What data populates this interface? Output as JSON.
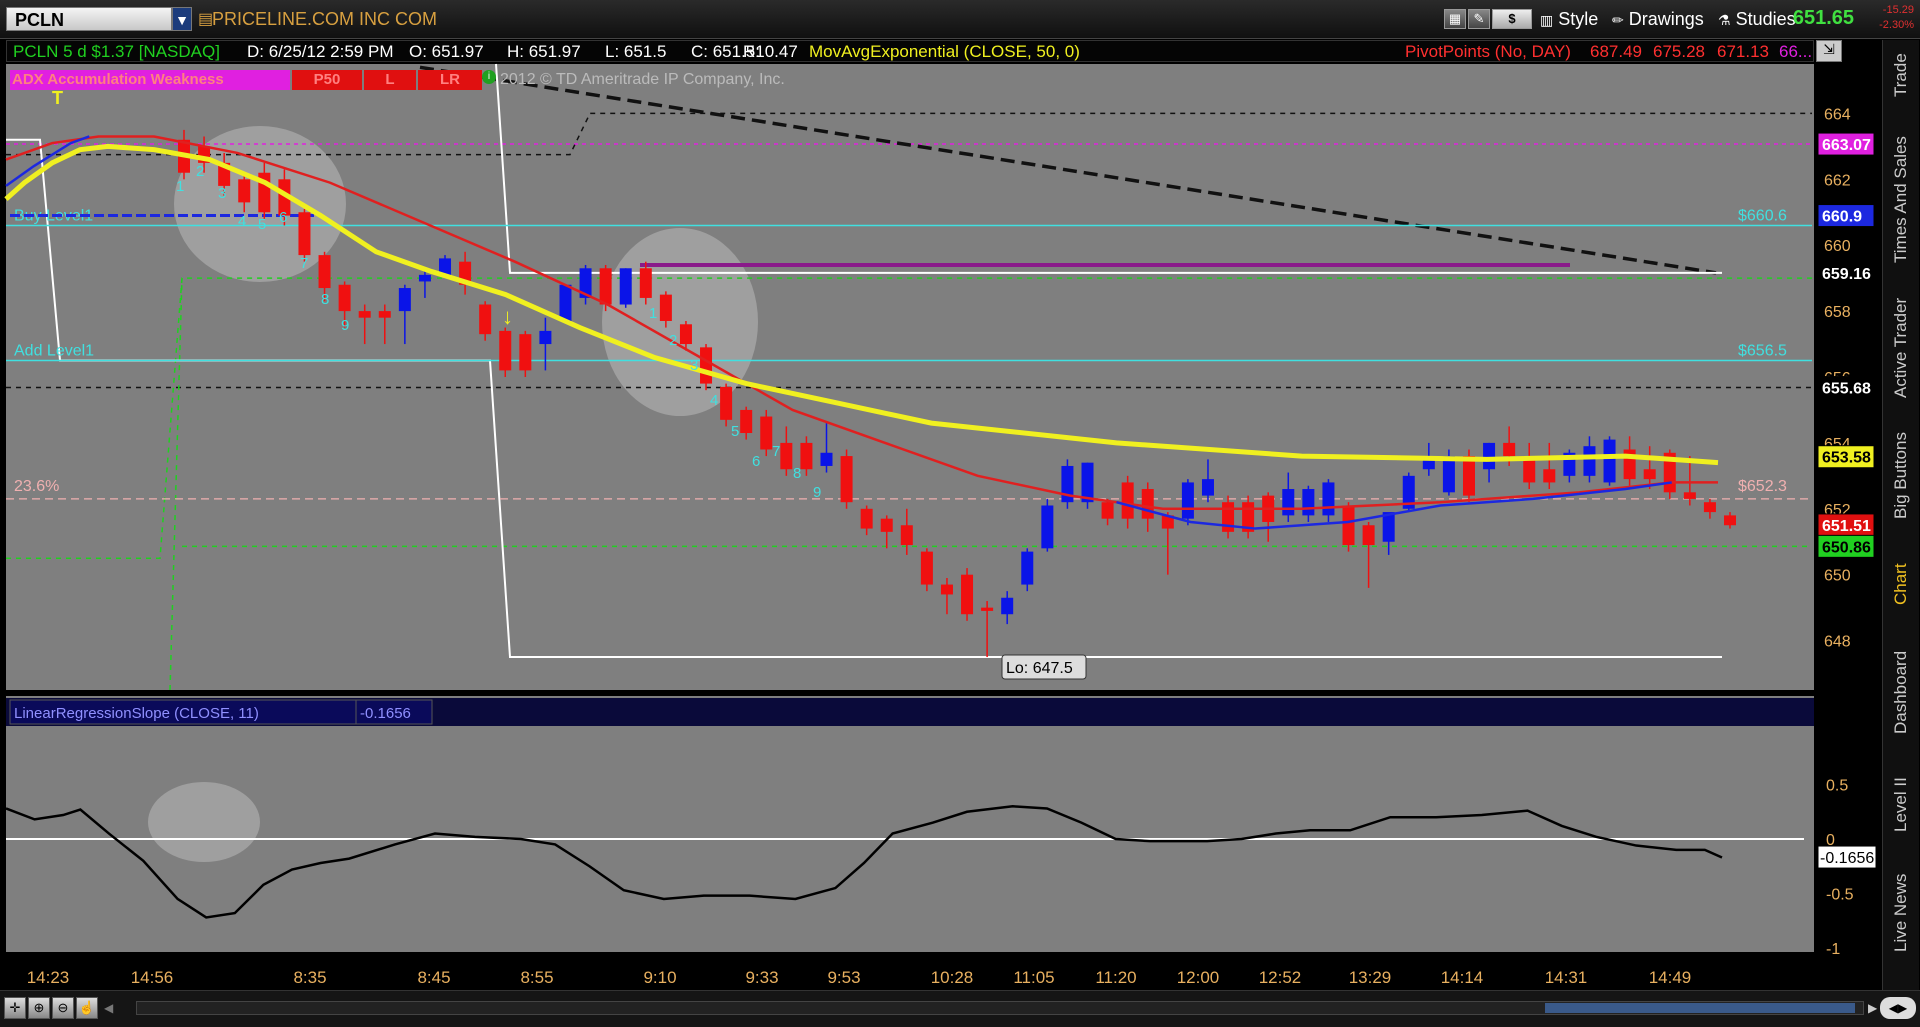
{
  "toolbar": {
    "symbol": "PCLN",
    "company": "PRICELINE.COM  INC COM",
    "dollar_label": "$",
    "style_label": "Style",
    "drawings_label": "Drawings",
    "studies_label": "Studies",
    "last_price": "651.65",
    "change_value": "-15.29",
    "change_percent": "-2.30%"
  },
  "info": {
    "symbol_period": "PCLN 5 d $1.37 [NASDAQ]",
    "date": "D: 6/25/12 2:59 PM",
    "open": "O: 651.97",
    "high": "H: 651.97",
    "low": "L: 651.5",
    "close": "C: 651.51",
    "range": "R: 0.47",
    "ema_study": "MovAvgExponential (CLOSE, 50, 0)",
    "pivot_study": "PivotPoints (No, DAY)",
    "pivot_v1": "687.49",
    "pivot_v2": "675.28",
    "pivot_v3": "671.13",
    "pivot_v4": "66..."
  },
  "legend_buttons": [
    "ADX Accumulation Weakness",
    "P50",
    "L",
    "LR"
  ],
  "copyright": "2012 © TD Ameritrade IP Company, Inc.",
  "sidebar_tabs": [
    "Trade",
    "Times And Sales",
    "Active Trader",
    "Big Buttons",
    "Chart",
    "Dashboard",
    "Level II",
    "Live News"
  ],
  "colors": {
    "up": "#0a14e8",
    "down": "#f01010",
    "panel": "#7f7f7f",
    "cyan": "#40e0e0",
    "ema50": "#f0f020",
    "ema_red": "#e02020",
    "ema_blue": "#1c28e0"
  },
  "chart_data": {
    "type": "candlestick",
    "ylim": [
      646.5,
      665.5
    ],
    "y_ticks": [
      648,
      650,
      652,
      654,
      656,
      658,
      660,
      662,
      664
    ],
    "x_tick_labels": [
      "14:23",
      "14:56",
      "8:35",
      "8:45",
      "8:55",
      "9:10",
      "9:33",
      "9:53",
      "10:28",
      "11:05",
      "11:20",
      "12:00",
      "12:52",
      "13:29",
      "14:14",
      "14:31",
      "14:49"
    ],
    "candles": [
      {
        "o": 663.2,
        "h": 663.5,
        "c": 662.2,
        "l": 662.0
      },
      {
        "o": 663.0,
        "h": 663.3,
        "c": 662.5,
        "l": 662.2
      },
      {
        "o": 662.5,
        "h": 662.8,
        "c": 661.8,
        "l": 661.5
      },
      {
        "o": 662.0,
        "h": 662.2,
        "c": 661.3,
        "l": 661.0
      },
      {
        "o": 662.2,
        "h": 662.5,
        "c": 661.0,
        "l": 660.8
      },
      {
        "o": 662.0,
        "h": 662.3,
        "c": 660.9,
        "l": 660.6
      },
      {
        "o": 661.0,
        "h": 661.1,
        "c": 659.7,
        "l": 659.5
      },
      {
        "o": 659.7,
        "h": 659.8,
        "c": 658.7,
        "l": 658.3
      },
      {
        "o": 658.8,
        "h": 658.9,
        "c": 658.0,
        "l": 657.5
      },
      {
        "o": 658.0,
        "h": 658.2,
        "c": 657.8,
        "l": 657.0
      },
      {
        "o": 658.0,
        "h": 658.2,
        "c": 657.8,
        "l": 657.0
      },
      {
        "o": 658.0,
        "h": 658.8,
        "c": 658.7,
        "l": 657.0
      },
      {
        "o": 658.9,
        "h": 659.2,
        "c": 659.1,
        "l": 658.4
      },
      {
        "o": 659.1,
        "h": 659.7,
        "c": 659.6,
        "l": 659.0
      },
      {
        "o": 659.5,
        "h": 659.8,
        "c": 658.8,
        "l": 658.5
      },
      {
        "o": 658.2,
        "h": 658.3,
        "c": 657.3,
        "l": 657.1
      },
      {
        "o": 657.4,
        "h": 657.5,
        "c": 656.2,
        "l": 656.0
      },
      {
        "o": 657.3,
        "h": 657.4,
        "c": 656.2,
        "l": 656.0
      },
      {
        "o": 657.0,
        "h": 657.8,
        "c": 657.4,
        "l": 656.2
      },
      {
        "o": 657.7,
        "h": 658.8,
        "c": 658.8,
        "l": 657.7
      },
      {
        "o": 658.4,
        "h": 659.4,
        "c": 659.3,
        "l": 658.2
      },
      {
        "o": 659.3,
        "h": 659.4,
        "c": 658.2,
        "l": 658.0
      },
      {
        "o": 658.2,
        "h": 659.3,
        "c": 659.3,
        "l": 658.1
      },
      {
        "o": 659.3,
        "h": 659.5,
        "c": 658.4,
        "l": 658.2
      },
      {
        "o": 658.5,
        "h": 658.6,
        "c": 657.7,
        "l": 657.5
      },
      {
        "o": 657.6,
        "h": 657.7,
        "c": 657.0,
        "l": 656.8
      },
      {
        "o": 656.9,
        "h": 657.0,
        "c": 655.8,
        "l": 655.6
      },
      {
        "o": 655.7,
        "h": 655.8,
        "c": 654.7,
        "l": 654.5
      },
      {
        "o": 655.0,
        "h": 655.1,
        "c": 654.3,
        "l": 654.1
      },
      {
        "o": 654.8,
        "h": 655.0,
        "c": 653.8,
        "l": 653.6
      },
      {
        "o": 654.0,
        "h": 654.5,
        "c": 653.2,
        "l": 653.0
      },
      {
        "o": 654.0,
        "h": 654.2,
        "c": 653.2,
        "l": 653.0
      },
      {
        "o": 653.3,
        "h": 654.6,
        "c": 653.7,
        "l": 653.1
      },
      {
        "o": 653.6,
        "h": 653.8,
        "c": 652.2,
        "l": 652.0
      },
      {
        "o": 652.0,
        "h": 652.1,
        "c": 651.4,
        "l": 651.2
      },
      {
        "o": 651.7,
        "h": 651.8,
        "c": 651.3,
        "l": 650.8
      },
      {
        "o": 651.5,
        "h": 652.0,
        "c": 650.9,
        "l": 650.6
      },
      {
        "o": 650.7,
        "h": 650.8,
        "c": 649.7,
        "l": 649.5
      },
      {
        "o": 649.7,
        "h": 649.9,
        "c": 649.4,
        "l": 648.8
      },
      {
        "o": 650.0,
        "h": 650.2,
        "c": 648.8,
        "l": 648.6
      },
      {
        "o": 649.0,
        "h": 649.2,
        "c": 648.9,
        "l": 647.5
      },
      {
        "o": 648.8,
        "h": 649.5,
        "c": 649.3,
        "l": 648.5
      },
      {
        "o": 649.7,
        "h": 650.8,
        "c": 650.7,
        "l": 649.5
      },
      {
        "o": 650.8,
        "h": 652.3,
        "c": 652.1,
        "l": 650.7
      },
      {
        "o": 652.2,
        "h": 653.5,
        "c": 653.3,
        "l": 652.0
      },
      {
        "o": 652.2,
        "h": 653.4,
        "c": 653.4,
        "l": 652.0
      },
      {
        "o": 652.2,
        "h": 652.3,
        "c": 651.7,
        "l": 651.5
      },
      {
        "o": 652.8,
        "h": 653.0,
        "c": 651.7,
        "l": 651.4
      },
      {
        "o": 652.6,
        "h": 652.8,
        "c": 651.7,
        "l": 651.3
      },
      {
        "o": 651.8,
        "h": 651.9,
        "c": 651.4,
        "l": 650.0
      },
      {
        "o": 651.7,
        "h": 652.9,
        "c": 652.8,
        "l": 651.5
      },
      {
        "o": 652.4,
        "h": 653.5,
        "c": 652.9,
        "l": 652.2
      },
      {
        "o": 652.2,
        "h": 652.4,
        "c": 651.3,
        "l": 651.1
      },
      {
        "o": 652.2,
        "h": 652.4,
        "c": 651.3,
        "l": 651.1
      },
      {
        "o": 652.4,
        "h": 652.5,
        "c": 651.6,
        "l": 651.0
      },
      {
        "o": 651.8,
        "h": 653.1,
        "c": 652.6,
        "l": 651.6
      },
      {
        "o": 651.8,
        "h": 652.7,
        "c": 652.6,
        "l": 651.6
      },
      {
        "o": 651.8,
        "h": 652.9,
        "c": 652.8,
        "l": 651.6
      },
      {
        "o": 652.1,
        "h": 652.2,
        "c": 650.9,
        "l": 650.7
      },
      {
        "o": 651.5,
        "h": 651.6,
        "c": 650.9,
        "l": 649.6
      },
      {
        "o": 651.0,
        "h": 651.2,
        "c": 651.9,
        "l": 650.6
      },
      {
        "o": 652.0,
        "h": 653.1,
        "c": 653.0,
        "l": 651.9
      },
      {
        "o": 653.2,
        "h": 654.0,
        "c": 653.5,
        "l": 653.0
      },
      {
        "o": 652.5,
        "h": 653.8,
        "c": 653.6,
        "l": 652.4
      },
      {
        "o": 653.6,
        "h": 653.8,
        "c": 652.4,
        "l": 652.2
      },
      {
        "o": 653.2,
        "h": 654.0,
        "c": 654.0,
        "l": 652.8
      },
      {
        "o": 654.0,
        "h": 654.5,
        "c": 653.6,
        "l": 653.3
      },
      {
        "o": 653.6,
        "h": 654.0,
        "c": 652.8,
        "l": 652.6
      },
      {
        "o": 653.2,
        "h": 654.0,
        "c": 652.8,
        "l": 652.6
      },
      {
        "o": 653.0,
        "h": 653.8,
        "c": 653.7,
        "l": 652.8
      },
      {
        "o": 653.0,
        "h": 654.2,
        "c": 653.9,
        "l": 652.8
      },
      {
        "o": 652.8,
        "h": 654.2,
        "c": 654.1,
        "l": 652.7
      },
      {
        "o": 653.8,
        "h": 654.2,
        "c": 652.9,
        "l": 652.7
      },
      {
        "o": 653.2,
        "h": 653.9,
        "c": 652.9,
        "l": 652.6
      },
      {
        "o": 653.7,
        "h": 653.8,
        "c": 652.5,
        "l": 652.3
      },
      {
        "o": 652.5,
        "h": 653.6,
        "c": 652.3,
        "l": 652.1
      },
      {
        "o": 652.2,
        "h": 652.3,
        "c": 651.9,
        "l": 651.7
      },
      {
        "o": 651.8,
        "h": 651.9,
        "c": 651.5,
        "l": 651.4
      }
    ],
    "ema50_yellow": [
      [
        0,
        661.4
      ],
      [
        2,
        661.9
      ],
      [
        5,
        662.5
      ],
      [
        8,
        662.9
      ],
      [
        11,
        663.0
      ],
      [
        16,
        662.9
      ],
      [
        22,
        662.6
      ],
      [
        28,
        661.9
      ],
      [
        34,
        660.9
      ],
      [
        40,
        659.8
      ],
      [
        46,
        659.2
      ],
      [
        54,
        658.5
      ],
      [
        62,
        657.5
      ],
      [
        70,
        656.6
      ],
      [
        80,
        655.8
      ],
      [
        90,
        655.2
      ],
      [
        100,
        654.6
      ],
      [
        120,
        654.0
      ],
      [
        140,
        653.6
      ],
      [
        160,
        653.5
      ],
      [
        175,
        653.6
      ],
      [
        185,
        653.4
      ]
    ],
    "ema_red": [
      [
        0,
        662.6
      ],
      [
        5,
        663.1
      ],
      [
        10,
        663.3
      ],
      [
        16,
        663.3
      ],
      [
        25,
        662.8
      ],
      [
        35,
        661.9
      ],
      [
        45,
        660.7
      ],
      [
        55,
        659.5
      ],
      [
        65,
        658.2
      ],
      [
        75,
        656.6
      ],
      [
        85,
        655.0
      ],
      [
        95,
        654.0
      ],
      [
        105,
        653.0
      ],
      [
        115,
        652.4
      ],
      [
        125,
        652.0
      ],
      [
        140,
        652.0
      ],
      [
        155,
        652.2
      ],
      [
        170,
        652.5
      ],
      [
        180,
        652.8
      ],
      [
        185,
        652.8
      ]
    ],
    "ema_blue": [
      [
        0,
        661.8
      ],
      [
        3,
        662.4
      ],
      [
        7,
        663.1
      ],
      [
        9,
        663.3
      ]
    ],
    "ema_blue_late": [
      [
        120,
        652.2
      ],
      [
        128,
        651.6
      ],
      [
        135,
        651.4
      ],
      [
        145,
        651.6
      ],
      [
        155,
        652.1
      ],
      [
        165,
        652.3
      ],
      [
        175,
        652.6
      ],
      [
        180,
        652.8
      ]
    ],
    "buy_level": {
      "label": "Buy Level1",
      "value": 660.6,
      "tag": "$660.6"
    },
    "add_level": {
      "label": "Add Level1",
      "value": 656.5,
      "tag": "$656.5"
    },
    "fib_level": {
      "label": "23.6%",
      "value": 652.3,
      "tag": "$652.3"
    },
    "price_tags": [
      {
        "label": "663.07",
        "value": 663.07,
        "bg": "#e020e0",
        "fg": "#ffffff"
      },
      {
        "label": "660.9",
        "value": 660.9,
        "bg": "#1c28e0",
        "fg": "#ffffff"
      },
      {
        "label": "659.16",
        "value": 659.16,
        "bg": "#000000",
        "fg": "#ffffff"
      },
      {
        "label": "655.68",
        "value": 655.68,
        "bg": "#000000",
        "fg": "#ffffff"
      },
      {
        "label": "653.58",
        "value": 653.58,
        "bg": "#f0f020",
        "fg": "#000000"
      },
      {
        "label": "651.51",
        "value": 651.51,
        "bg": "#e01010",
        "fg": "#ffffff"
      },
      {
        "label": "650.86",
        "value": 650.86,
        "bg": "#20d020",
        "fg": "#000000"
      }
    ],
    "low_label": "Lo: 647.5",
    "oscillator": {
      "title": "LinearRegressionSlope (CLOSE, 11)",
      "value": "-0.1656",
      "ylim": [
        -1,
        1
      ],
      "y_ticks": [
        0.5,
        0,
        -0.5,
        -1
      ],
      "series": [
        [
          0,
          0.28
        ],
        [
          5,
          0.18
        ],
        [
          10,
          0.22
        ],
        [
          13,
          0.27
        ],
        [
          18,
          0.05
        ],
        [
          24,
          -0.2
        ],
        [
          30,
          -0.55
        ],
        [
          35,
          -0.72
        ],
        [
          40,
          -0.68
        ],
        [
          45,
          -0.42
        ],
        [
          50,
          -0.28
        ],
        [
          55,
          -0.22
        ],
        [
          60,
          -0.18
        ],
        [
          68,
          -0.05
        ],
        [
          75,
          0.05
        ],
        [
          82,
          0.02
        ],
        [
          90,
          0.0
        ],
        [
          96,
          -0.05
        ],
        [
          102,
          -0.25
        ],
        [
          108,
          -0.47
        ],
        [
          115,
          -0.55
        ],
        [
          122,
          -0.52
        ],
        [
          130,
          -0.52
        ],
        [
          138,
          -0.55
        ],
        [
          145,
          -0.45
        ],
        [
          150,
          -0.22
        ],
        [
          155,
          0.05
        ],
        [
          162,
          0.15
        ],
        [
          168,
          0.25
        ],
        [
          176,
          0.3
        ],
        [
          182,
          0.28
        ],
        [
          188,
          0.15
        ],
        [
          194,
          0.0
        ],
        [
          200,
          -0.02
        ],
        [
          210,
          -0.02
        ],
        [
          216,
          0.0
        ],
        [
          222,
          0.05
        ],
        [
          228,
          0.08
        ],
        [
          235,
          0.08
        ],
        [
          242,
          0.2
        ],
        [
          250,
          0.2
        ],
        [
          258,
          0.22
        ],
        [
          266,
          0.26
        ],
        [
          272,
          0.12
        ],
        [
          278,
          0.02
        ],
        [
          285,
          -0.06
        ],
        [
          292,
          -0.1
        ],
        [
          297,
          -0.1
        ],
        [
          300,
          -0.17
        ]
      ]
    },
    "sequence_labels": [
      "1",
      "2",
      "3",
      "4",
      "5",
      "6",
      "7",
      "8",
      "9",
      "1",
      "2",
      "3",
      "4",
      "5",
      "6",
      "7",
      "8",
      "9"
    ]
  }
}
